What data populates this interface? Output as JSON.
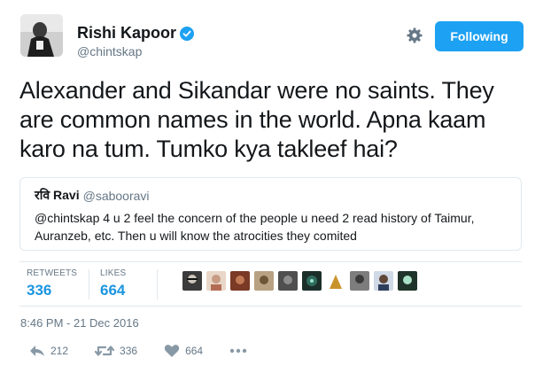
{
  "user": {
    "name": "Rishi Kapoor",
    "handle": "@chintskap",
    "follow_label": "Following"
  },
  "tweet": {
    "text": "Alexander and Sikandar were no saints. They are common names in the world. Apna kaam karo na tum. Tumko kya takleef hai?"
  },
  "quoted": {
    "name": "रवि Ravi",
    "handle": "@sabooravi",
    "text": "@chintskap 4 u 2 feel the concern of the people u need 2 read history of Taimur, Auranzeb, etc. Then u will know the atrocities they comited"
  },
  "stats": {
    "retweets_label": "RETWEETS",
    "retweets": "336",
    "likes_label": "LIKES",
    "likes": "664"
  },
  "timestamp": "8:46 PM - 21 Dec 2016",
  "actions": {
    "reply_count": "212",
    "retweet_count": "336",
    "like_count": "664"
  },
  "colors": {
    "accent": "#1da1f2",
    "link": "#1b95e0",
    "muted": "#657786"
  },
  "icons": [
    "verified-badge-icon",
    "gear-icon",
    "reply-icon",
    "retweet-icon",
    "heart-icon",
    "more-icon"
  ]
}
